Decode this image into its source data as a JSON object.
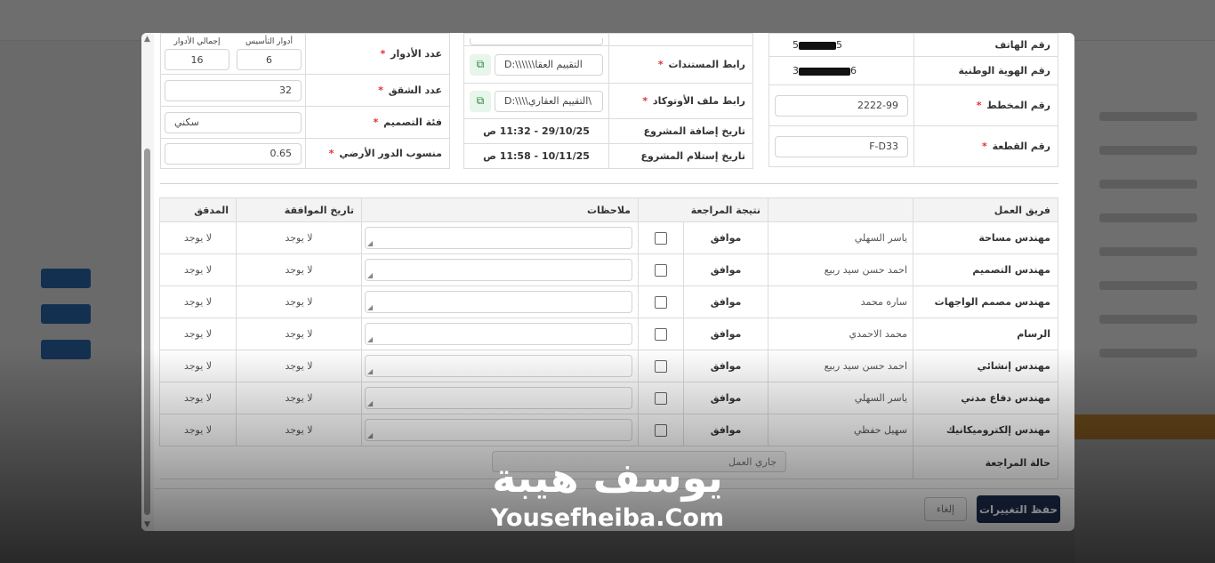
{
  "property": {
    "phone_label": "رقم الهاتف",
    "phone_prefix": "5",
    "phone_suffix": "5",
    "national_id_label": "رقم الهوية الوطنية",
    "national_id_prefix": "3",
    "national_id_suffix": "6",
    "plan_label": "رقم المخطط",
    "plan_value": "2222-99",
    "plot_label": "رقم القطعة",
    "plot_value": "F-D33"
  },
  "documents": {
    "docs_link_label": "رابط المستندات",
    "docs_link_value": "D:\\\\\\\\\\\\التقييم العقا",
    "autocad_link_label": "رابط ملف الأوتوكاد",
    "autocad_link_value": "D:\\\\\\\\التقييم العقاري\\",
    "added_date_label": "تاريخ إضافة المشروع",
    "added_date_value": "29/10/25 - 11:32 ص",
    "received_date_label": "تاريخ إستلام المشروع",
    "received_date_value": "10/11/25 - 11:58 ص"
  },
  "building": {
    "floors_label": "عدد الأدوار",
    "foundation_floors_label": "أدوار التأسيس",
    "foundation_floors_value": "6",
    "total_floors_label": "إجمالي الأدوار",
    "total_floors_value": "16",
    "apartments_label": "عدد الشقق",
    "apartments_value": "32",
    "design_category_label": "فئة التصميم",
    "design_category_value": "سكني",
    "ground_level_label": "منسوب الدور الأرضي",
    "ground_level_value": "0.65"
  },
  "team": {
    "headers": {
      "team": "فريق العمل",
      "result": "نتيجة المراجعة",
      "notes": "ملاحظات",
      "approval_date": "تاريخ الموافقة",
      "auditor": "المدقق"
    },
    "rows": [
      {
        "role": "مهندس مساحة",
        "name": "ياسر السهلي",
        "result": "موافق",
        "date": "لا يوجد",
        "auditor": "لا يوجد"
      },
      {
        "role": "مهندس التصميم",
        "name": "احمد حسن سيد ربيع",
        "result": "موافق",
        "date": "لا يوجد",
        "auditor": "لا يوجد"
      },
      {
        "role": "مهندس مصمم الواجهات",
        "name": "ساره محمد",
        "result": "موافق",
        "date": "لا يوجد",
        "auditor": "لا يوجد"
      },
      {
        "role": "الرسام",
        "name": "محمد الاحمدي",
        "result": "موافق",
        "date": "لا يوجد",
        "auditor": "لا يوجد"
      },
      {
        "role": "مهندس إنشائي",
        "name": "احمد حسن سيد ربيع",
        "result": "موافق",
        "date": "لا يوجد",
        "auditor": "لا يوجد"
      },
      {
        "role": "مهندس دفاع مدني",
        "name": "ياسر السهلي",
        "result": "موافق",
        "date": "لا يوجد",
        "auditor": "لا يوجد"
      },
      {
        "role": "مهندس إلكتروميكانيك",
        "name": "سهيل حفظي",
        "result": "موافق",
        "date": "لا يوجد",
        "auditor": "لا يوجد"
      }
    ],
    "status_label": "حالة المراجعة",
    "status_value": "جاري العمل"
  },
  "footer": {
    "save_label": "حفظ التغييرات",
    "cancel_label": "إلغاء"
  },
  "watermark": {
    "arabic": "يوسف هيبة",
    "english": "Yousefheiba.Com"
  },
  "icons": {
    "copy": "copy-icon",
    "scroll_up": "scroll-up-icon",
    "scroll_down": "scroll-down-icon"
  },
  "colors": {
    "primary": "#1d2d50",
    "required": "#e0322c",
    "copy_green": "#1f8a3a"
  }
}
